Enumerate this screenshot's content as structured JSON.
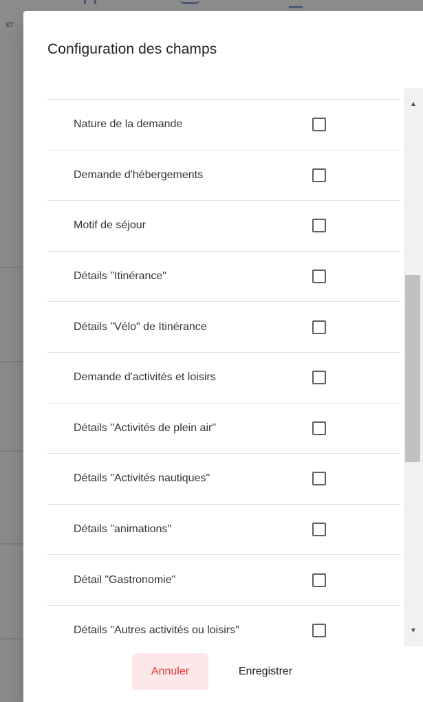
{
  "background": {
    "fragment_text": "er"
  },
  "dialog": {
    "title": "Configuration des champs",
    "fields": [
      {
        "label": "Nature de la demande",
        "checked": false
      },
      {
        "label": "Demande d'hébergements",
        "checked": false
      },
      {
        "label": "Motif de séjour",
        "checked": false
      },
      {
        "label": "Détails \"Itinérance\"",
        "checked": false
      },
      {
        "label": "Détails \"Vélo\" de Itinérance",
        "checked": false
      },
      {
        "label": "Demande d'activités et loisirs",
        "checked": false
      },
      {
        "label": "Détails \"Activités de plein air\"",
        "checked": false
      },
      {
        "label": "Détails \"Activités nautiques\"",
        "checked": false
      },
      {
        "label": "Détails \"animations\"",
        "checked": false
      },
      {
        "label": "Détail \"Gastronomie\"",
        "checked": false
      },
      {
        "label": "Détails \"Autres activités ou loisirs\"",
        "checked": false
      }
    ],
    "actions": {
      "cancel_label": "Annuler",
      "save_label": "Enregistrer"
    },
    "scrollbar": {
      "up_arrow": "▲",
      "down_arrow": "▼"
    }
  },
  "colors": {
    "cancel_bg": "#fde7e8",
    "cancel_text": "#e53935",
    "overlay": "#8c8c8c"
  }
}
